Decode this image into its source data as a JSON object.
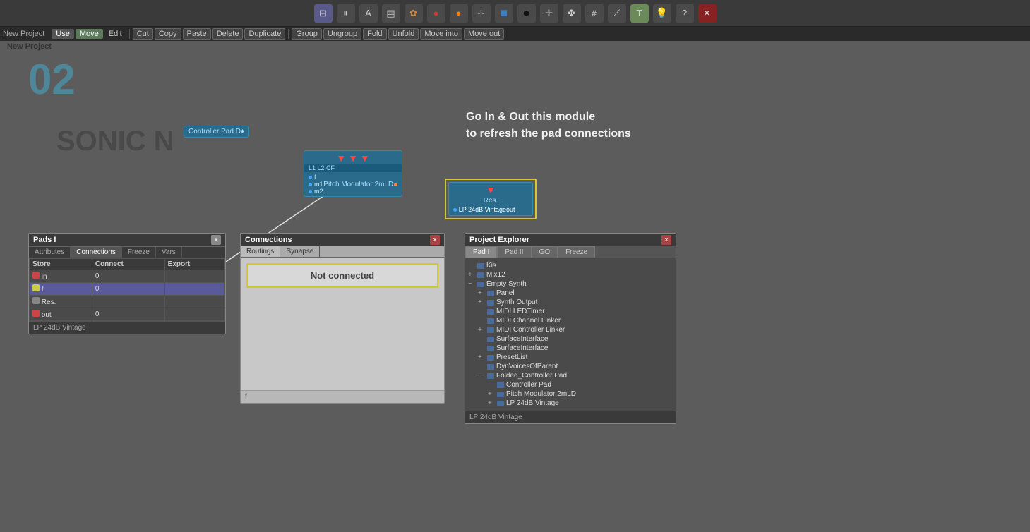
{
  "topbar": {
    "icons": [
      {
        "name": "grid-icon",
        "symbol": "⊞"
      },
      {
        "name": "pause-icon",
        "symbol": "⏸"
      },
      {
        "name": "text-icon",
        "symbol": "A"
      },
      {
        "name": "layers-icon",
        "symbol": "▤"
      },
      {
        "name": "target-icon",
        "symbol": "✿"
      },
      {
        "name": "red-circle",
        "symbol": "●",
        "color": "#e03030"
      },
      {
        "name": "orange-circle",
        "symbol": "●",
        "color": "#f08000"
      },
      {
        "name": "checker-icon",
        "symbol": "⊹"
      },
      {
        "name": "blue-square",
        "symbol": "■",
        "color": "#4080c0"
      },
      {
        "name": "black-circle",
        "symbol": "●",
        "color": "#111"
      },
      {
        "name": "move-icon",
        "symbol": "✛"
      },
      {
        "name": "cross-icon",
        "symbol": "✤"
      },
      {
        "name": "hash-icon",
        "symbol": "#"
      },
      {
        "name": "diagonal-icon",
        "symbol": "⟋"
      },
      {
        "name": "tip-icon",
        "symbol": "T"
      },
      {
        "name": "info-icon",
        "symbol": "i"
      },
      {
        "name": "help-icon",
        "symbol": "?"
      },
      {
        "name": "close-icon",
        "symbol": "✕"
      }
    ]
  },
  "menubar": {
    "project_name": "New Project",
    "items": [
      {
        "label": "Use",
        "active": false
      },
      {
        "label": "Move",
        "active": true
      },
      {
        "label": "Edit",
        "active": false
      }
    ],
    "buttons": [
      "Cut",
      "Copy",
      "Paste",
      "Delete",
      "Duplicate",
      "Group",
      "Ungroup",
      "Fold",
      "Unfold",
      "Move into",
      "Move out"
    ]
  },
  "canvas": {
    "large_number": "02",
    "watermark": "SONIC N",
    "instruction_line1": "Go In & Out this module",
    "instruction_line2": "to refresh the pad connections"
  },
  "nodes": {
    "controller_pad": {
      "label": "Controller Pad D♦"
    },
    "pitch_modulator": {
      "top_label": "L1 L2 CF",
      "label": "Pitch Modulator 2mLD",
      "ports": [
        "f",
        "m1",
        "m2"
      ]
    },
    "lp_24db": {
      "label": "Res.",
      "full_label": "LP 24dB Vintageout"
    }
  },
  "pads_panel": {
    "title": "Pads I",
    "tabs": [
      "Attributes",
      "Connections",
      "Freeze",
      "Vars"
    ],
    "active_tab": "Connections",
    "columns": [
      "Store",
      "Connect",
      "Export"
    ],
    "rows": [
      {
        "indicator": "red",
        "name": "in",
        "connect": "0",
        "selected": false
      },
      {
        "indicator": "yellow",
        "name": "f",
        "connect": "0",
        "selected": true
      },
      {
        "indicator": "gray",
        "name": "Res.",
        "connect": "",
        "selected": false
      },
      {
        "indicator": "red",
        "name": "out",
        "connect": "0",
        "selected": false
      }
    ],
    "footer": "LP 24dB Vintage"
  },
  "connections_panel": {
    "title": "Connections",
    "tabs": [
      "Routings",
      "Synapse"
    ],
    "active_tab": "Routings",
    "not_connected_label": "Not connected",
    "footer": "f"
  },
  "explorer_panel": {
    "title": "Project Explorer",
    "tabs": [
      "Pad I",
      "Pad II",
      "GO",
      "Freeze"
    ],
    "active_tab": "Pad I",
    "tree": [
      {
        "label": "Kis",
        "indent": 0,
        "expand": null,
        "has_icon": true
      },
      {
        "label": "Mix12",
        "indent": 0,
        "expand": "+",
        "has_icon": true
      },
      {
        "label": "Empty Synth",
        "indent": 0,
        "expand": "-",
        "has_icon": true
      },
      {
        "label": "Panel",
        "indent": 1,
        "expand": "+",
        "has_icon": true
      },
      {
        "label": "Synth Output",
        "indent": 1,
        "expand": "+",
        "has_icon": true
      },
      {
        "label": "MIDI LEDTimer",
        "indent": 1,
        "expand": null,
        "has_icon": true
      },
      {
        "label": "MIDI Channel Linker",
        "indent": 1,
        "expand": null,
        "has_icon": true
      },
      {
        "label": "MIDI Controller Linker",
        "indent": 1,
        "expand": "+",
        "has_icon": true
      },
      {
        "label": "SurfaceInterface",
        "indent": 1,
        "expand": null,
        "has_icon": true
      },
      {
        "label": "SurfaceInterface",
        "indent": 1,
        "expand": null,
        "has_icon": true
      },
      {
        "label": "PresetList",
        "indent": 1,
        "expand": "+",
        "has_icon": true
      },
      {
        "label": "DynVoicesOfParent",
        "indent": 1,
        "expand": null,
        "has_icon": true
      },
      {
        "label": "Folded_Controller Pad",
        "indent": 1,
        "expand": "-",
        "has_icon": true
      },
      {
        "label": "Controller Pad",
        "indent": 2,
        "expand": null,
        "has_icon": true
      },
      {
        "label": "Pitch Modulator 2mLD",
        "indent": 2,
        "expand": "+",
        "has_icon": true
      },
      {
        "label": "LP 24dB Vintage",
        "indent": 2,
        "expand": "+",
        "has_icon": true
      }
    ],
    "footer": "LP 24dB Vintage"
  }
}
